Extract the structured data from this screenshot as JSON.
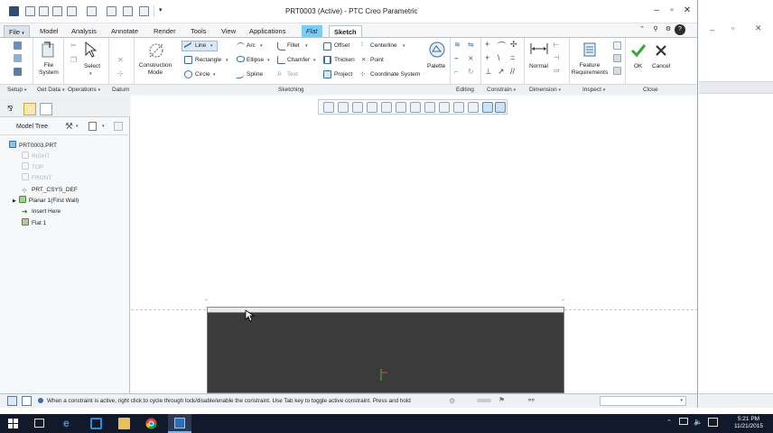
{
  "window": {
    "title": "PRT0003 (Active) - PTC Creo Parametric"
  },
  "tabs": [
    {
      "label": "File",
      "suffix": "▾"
    },
    {
      "label": "Model"
    },
    {
      "label": "Analysis"
    },
    {
      "label": "Annotate"
    },
    {
      "label": "Render"
    },
    {
      "label": "Tools"
    },
    {
      "label": "View"
    },
    {
      "label": "Applications"
    },
    {
      "label": "Flat"
    },
    {
      "label": "Sketch"
    }
  ],
  "ribbon": {
    "file_system": "File\nSystem",
    "select": "Select",
    "construction_mode": "Construction\nMode",
    "sketching": {
      "line": "Line",
      "rectangle": "Rectangle",
      "circle": "Circle",
      "arc": "Arc",
      "ellipse": "Ellipse",
      "spline": "Spline",
      "fillet": "Fillet",
      "chamfer": "Chamfer",
      "text": "Text",
      "offset": "Offset",
      "thicken": "Thicken",
      "project": "Project",
      "centerline": "Centerline",
      "point": "Point",
      "coordinate_system": "Coordinate System",
      "palette": "Palette"
    },
    "normal": "Normal",
    "feature_requirements": "Feature\nRequirements",
    "ok": "OK",
    "cancel": "Cancel",
    "groups": {
      "setup": "Setup",
      "get_data": "Get Data",
      "operations": "Operations",
      "datum": "Datum",
      "sketching": "Sketching",
      "editing": "Editing",
      "constrain": "Constrain",
      "dimension": "Dimension",
      "inspect": "Inspect",
      "close": "Close"
    }
  },
  "model_tree": {
    "title": "Model Tree",
    "items": [
      {
        "label": "PRT0003.PRT",
        "state": "normal"
      },
      {
        "label": "RIGHT",
        "state": "hidden"
      },
      {
        "label": "TOP",
        "state": "hidden"
      },
      {
        "label": "FRONT",
        "state": "hidden"
      },
      {
        "label": "PRT_CSYS_DEF",
        "state": "normal"
      },
      {
        "label": "Planar 1(First Wall)",
        "state": "normal"
      },
      {
        "label": "Insert Here",
        "state": "normal"
      },
      {
        "label": "Flat 1",
        "state": "normal"
      }
    ]
  },
  "status": {
    "message": "When a constraint is active, right click to cycle through lock/disable/enable the constraint. Use Tab key to toggle active constraint. Press and hold"
  },
  "taskbar": {
    "time": "5:21 PM",
    "date": "11/21/2015"
  },
  "colors": {
    "flat_tab": "#7ecbf0",
    "part_fill": "#3b3b3b",
    "ok_check": "#3aa33a",
    "cancel_x": "#333333"
  }
}
